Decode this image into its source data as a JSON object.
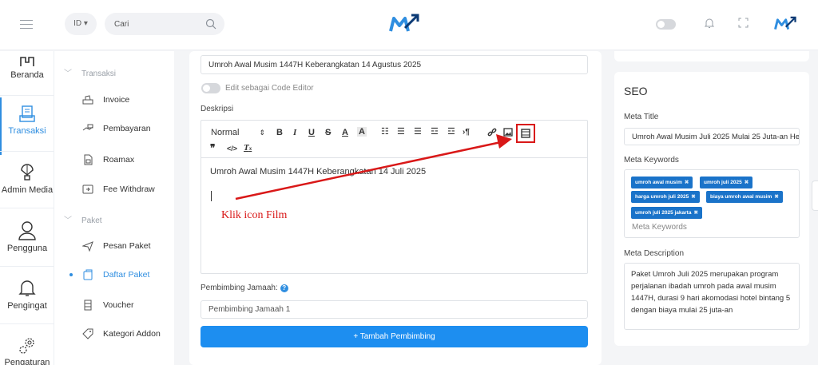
{
  "header": {
    "language": "ID ▾",
    "search_placeholder": "Cari"
  },
  "rail": {
    "items": [
      {
        "label": "Beranda",
        "icon": "home-icon"
      },
      {
        "label": "Transaksi",
        "icon": "receipt-icon",
        "active": true
      },
      {
        "label": "Admin Media",
        "icon": "balloon-icon"
      },
      {
        "label": "Pengguna",
        "icon": "user-icon"
      },
      {
        "label": "Pengingat",
        "icon": "bell-icon"
      },
      {
        "label": "Pengaturan",
        "icon": "gear-icon"
      }
    ]
  },
  "submenu": {
    "section1": "Transaksi",
    "items1": [
      "Invoice",
      "Pembayaran",
      "Roamax",
      "Fee Withdraw"
    ],
    "section2": "Paket",
    "items2": [
      "Pesan Paket",
      "Daftar Paket",
      "Voucher",
      "Kategori Addon"
    ]
  },
  "form": {
    "title_value": "Umroh Awal Musim 1447H Keberangkatan 14 Agustus 2025",
    "code_editor_label": "Edit sebagai Code Editor",
    "description_label": "Deskripsi",
    "format_select": "Normal",
    "editor_text": "Umroh Awal Musim 1447H Keberangkatan 14 Juli 2025",
    "annotation": "Klik icon Film",
    "pembimbing_label": "Pembimbing Jamaah:",
    "pembimbing_value": "Pembimbing Jamaah 1",
    "add_button": "+ Tambah Pembimbing"
  },
  "seo": {
    "title": "SEO",
    "meta_title_label": "Meta Title",
    "meta_title_value": "Umroh Awal Musim Juli 2025 Mulai 25 Juta-an He",
    "meta_keywords_label": "Meta Keywords",
    "keywords": [
      "umroh awal musim",
      "umroh juli 2025",
      "harga umroh juli 2025",
      "biaya umroh awal musim",
      "umroh juli 2025 jakarta"
    ],
    "keywords_placeholder": "Meta Keywords",
    "meta_description_label": "Meta Description",
    "meta_description_value": "Paket Umroh Juli 2025 merupakan program perjalanan ibadah umroh pada awal musim 1447H, durasi 9 hari akomodasi hotel bintang 5 dengan biaya mulai 25 juta-an"
  },
  "colors": {
    "accent": "#2f8ee0",
    "button": "#1d8ef0",
    "tag": "#1a73c9",
    "annotation": "#d91818"
  }
}
